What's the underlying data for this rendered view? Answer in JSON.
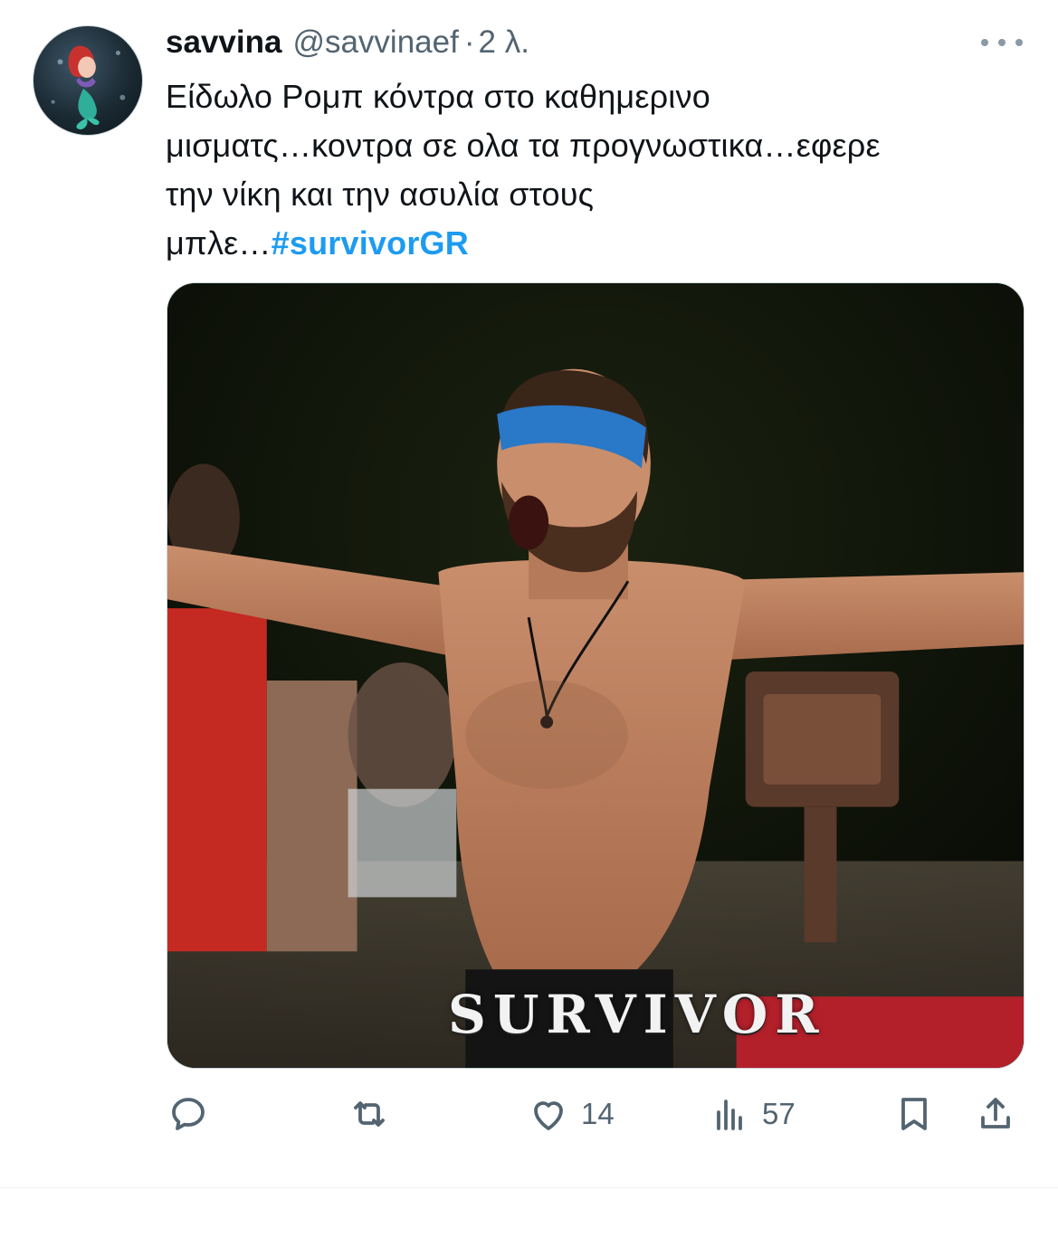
{
  "tweet": {
    "display_name": "savvina",
    "handle": "@savvinaef",
    "separator": "·",
    "time": "2 λ.",
    "text_lines": [
      "Είδωλο Ρομπ κόντρα στο καθημερινο",
      "μισματς…κοντρα σε ολα τα προγνωστικα…εφερε",
      "την νίκη και την ασυλία στους"
    ],
    "text_last_prefix": "μπλε…",
    "hashtag": "#survivorGR",
    "media_wordmark": "SURVIVOR"
  },
  "actions": {
    "reply": {
      "icon": "reply-icon"
    },
    "retweet": {
      "icon": "retweet-icon"
    },
    "like": {
      "icon": "heart-icon",
      "count": "14"
    },
    "views": {
      "icon": "views-chart-icon",
      "count": "57"
    },
    "bookmark": {
      "icon": "bookmark-icon"
    },
    "share": {
      "icon": "share-icon"
    }
  },
  "colors": {
    "primary_text": "#0f1419",
    "secondary_text": "#536471",
    "link": "#1d9bf0",
    "border": "#cfd9de"
  }
}
